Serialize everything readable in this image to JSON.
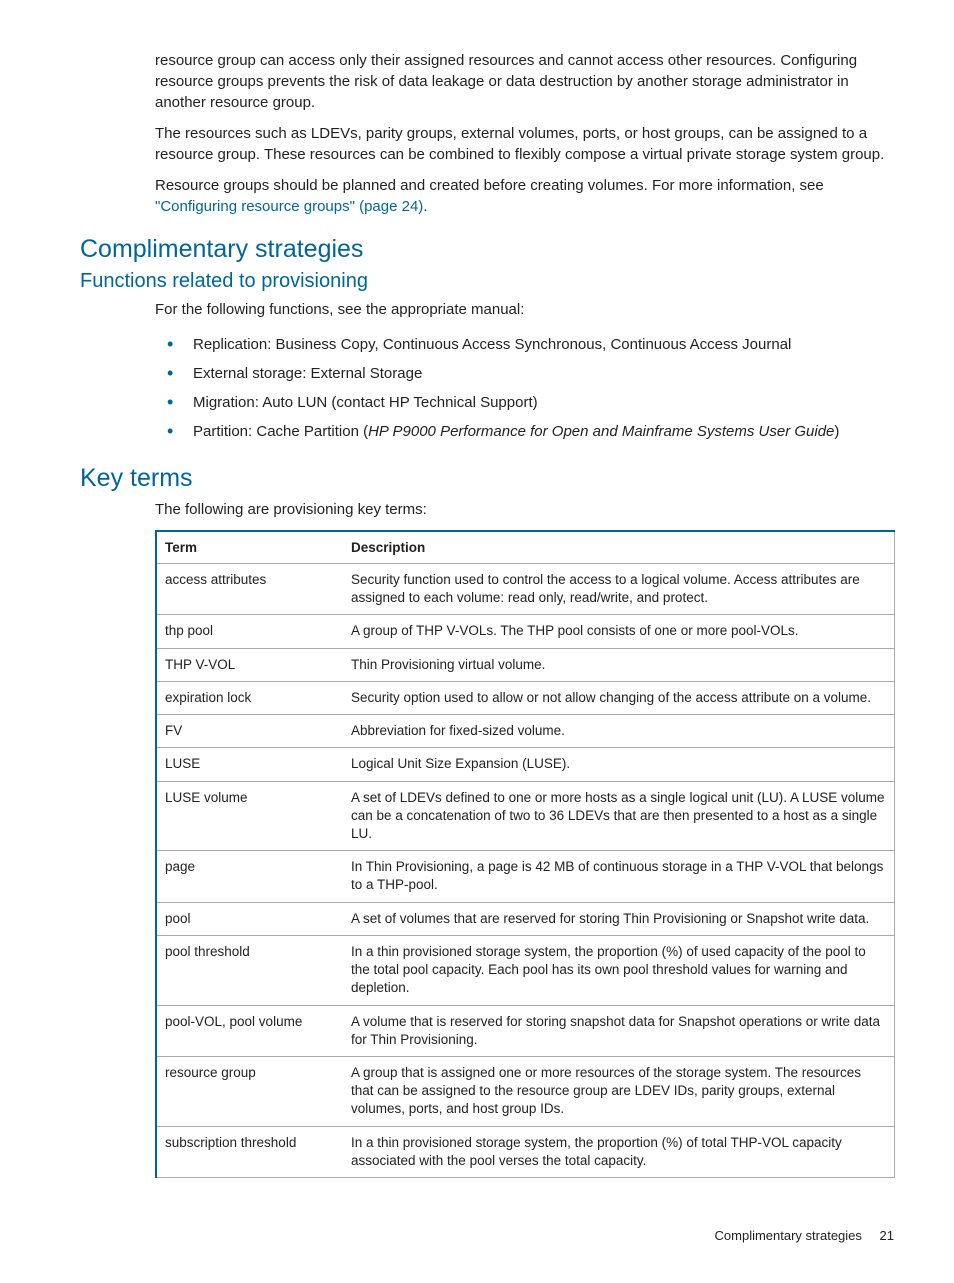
{
  "intro": {
    "p1": "resource group can access only their assigned resources and cannot access other resources. Configuring resource groups prevents the risk of data leakage or data destruction by another storage administrator in another resource group.",
    "p2": "The resources such as LDEVs, parity groups, external volumes, ports, or host groups, can be assigned to a resource group. These resources can be combined to flexibly compose a virtual private storage system group.",
    "p3a": "Resource groups should be planned and created before creating volumes. For more information, see ",
    "p3link": "\"Configuring resource groups\" (page 24)",
    "p3b": "."
  },
  "h1a": "Complimentary strategies",
  "h2a": "Functions related to provisioning",
  "funcs_intro": "For the following functions, see the appropriate manual:",
  "funcs": {
    "i0": "Replication: Business Copy, Continuous Access Synchronous, Continuous Access Journal",
    "i1": "External storage: External Storage",
    "i2": "Migration: Auto LUN (contact HP Technical Support)",
    "i3a": "Partition: Cache Partition (",
    "i3em": "HP P9000 Performance for Open and Mainframe Systems User Guide",
    "i3b": ")"
  },
  "h1b": "Key terms",
  "terms_intro": "The following are provisioning key terms:",
  "thead": {
    "c0": "Term",
    "c1": "Description"
  },
  "rows": {
    "r0": {
      "t": "access attributes",
      "d": "Security function used to control the access to a logical volume. Access attributes are assigned to each volume: read only, read/write, and protect."
    },
    "r1": {
      "t": "thp pool",
      "d": "A group of THP V-VOLs. The THP pool consists of one or more pool-VOLs."
    },
    "r2": {
      "t": "THP V-VOL",
      "d": "Thin Provisioning virtual volume."
    },
    "r3": {
      "t": "expiration lock",
      "d": "Security option used to allow or not allow changing of the access attribute on a volume."
    },
    "r4": {
      "t": "FV",
      "d": "Abbreviation for fixed-sized volume."
    },
    "r5": {
      "t": "LUSE",
      "d": "Logical Unit Size Expansion (LUSE)."
    },
    "r6": {
      "t": "LUSE volume",
      "d": "A set of LDEVs defined to one or more hosts as a single logical unit (LU). A LUSE volume can be a concatenation of two to 36 LDEVs that are then presented to a host as a single LU."
    },
    "r7": {
      "t": "page",
      "d": "In Thin Provisioning, a page is 42 MB of continuous storage in a THP V-VOL that belongs to a THP-pool."
    },
    "r8": {
      "t": "pool",
      "d": "A set of volumes that are reserved for storing Thin Provisioning or Snapshot write data."
    },
    "r9": {
      "t": "pool threshold",
      "d": "In a thin provisioned storage system, the proportion (%) of used capacity of the pool to the total pool capacity. Each pool has its own pool threshold values for warning and depletion."
    },
    "r10": {
      "t": "pool-VOL, pool volume",
      "d": "A volume that is reserved for storing snapshot data for Snapshot operations or write data for Thin Provisioning."
    },
    "r11": {
      "t": "resource group",
      "d": "A group that is assigned one or more resources of the storage system. The resources that can be assigned to the resource group are LDEV IDs, parity groups, external volumes, ports, and host group IDs."
    },
    "r12": {
      "t": "subscription threshold",
      "d": "In a thin provisioned storage system, the proportion (%) of total THP-VOL capacity associated with the pool verses the total capacity."
    }
  },
  "footer": {
    "section": "Complimentary strategies",
    "page": "21"
  }
}
